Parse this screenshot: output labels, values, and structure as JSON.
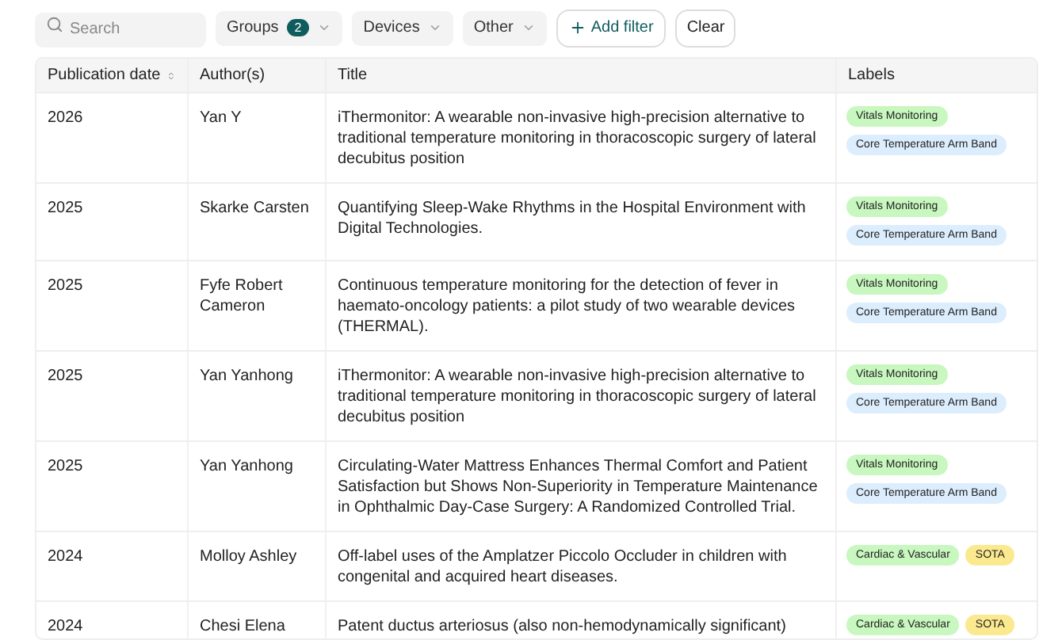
{
  "search": {
    "placeholder": "Search"
  },
  "filters": [
    {
      "label": "Groups",
      "count": "2"
    },
    {
      "label": "Devices"
    },
    {
      "label": "Other"
    }
  ],
  "add_filter": "Add filter",
  "clear": "Clear",
  "table": {
    "columns": [
      {
        "label": "Publication date",
        "sortable": true
      },
      {
        "label": "Author(s)",
        "sortable": false
      },
      {
        "label": "Title",
        "sortable": false
      },
      {
        "label": "Labels",
        "sortable": false
      }
    ],
    "rows": [
      {
        "date": "2026",
        "authors": "Yan Y",
        "title": "iThermonitor: A wearable non-invasive high-precision alternative to traditional temperature monitoring in thoracoscopic surgery of lateral decubitus position",
        "labels": [
          {
            "text": "Vitals Monitoring",
            "color": "#c8f7bf"
          },
          {
            "text": "Core Temperature Arm Band",
            "color": "#dcedfd"
          }
        ]
      },
      {
        "date": "2025",
        "authors": "Skarke Carsten",
        "title": "Quantifying Sleep-Wake Rhythms in the Hospital Environment with Digital Technologies.",
        "labels": [
          {
            "text": "Vitals Monitoring",
            "color": "#c8f7bf"
          },
          {
            "text": "Core Temperature Arm Band",
            "color": "#dcedfd"
          }
        ]
      },
      {
        "date": "2025",
        "authors": "Fyfe Robert Cameron",
        "title": "Continuous temperature monitoring for the detection of fever in haemato-oncology patients: a pilot study of two wearable devices (THERMAL).",
        "labels": [
          {
            "text": "Vitals Monitoring",
            "color": "#c8f7bf"
          },
          {
            "text": "Core Temperature Arm Band",
            "color": "#dcedfd"
          }
        ]
      },
      {
        "date": "2025",
        "authors": "Yan Yanhong",
        "title": "iThermonitor: A wearable non-invasive high-precision alternative to traditional temperature monitoring in thoracoscopic surgery of lateral decubitus position",
        "labels": [
          {
            "text": "Vitals Monitoring",
            "color": "#c8f7bf"
          },
          {
            "text": "Core Temperature Arm Band",
            "color": "#dcedfd"
          }
        ]
      },
      {
        "date": "2025",
        "authors": "Yan Yanhong",
        "title": "Circulating-Water Mattress Enhances Thermal Comfort and Patient Satisfaction but Shows Non-Superiority in Temperature Maintenance in Ophthalmic Day-Case Surgery: A Randomized Controlled Trial.",
        "labels": [
          {
            "text": "Vitals Monitoring",
            "color": "#c8f7bf"
          },
          {
            "text": "Core Temperature Arm Band",
            "color": "#dcedfd"
          }
        ]
      },
      {
        "date": "2024",
        "authors": "Molloy Ashley",
        "title": "Off-label uses of the Amplatzer Piccolo Occluder in children with congenital and acquired heart diseases.",
        "labels": [
          {
            "text": "Cardiac & Vascular",
            "color": "#c8f7bf"
          },
          {
            "text": "SOTA",
            "color": "#fbe98f"
          }
        ]
      },
      {
        "date": "2024",
        "authors": "Chesi Elena",
        "title": "Patent ductus arteriosus (also non-hemodynamically significant)",
        "labels": [
          {
            "text": "Cardiac & Vascular",
            "color": "#c8f7bf"
          },
          {
            "text": "SOTA",
            "color": "#fbe98f"
          }
        ]
      }
    ]
  }
}
